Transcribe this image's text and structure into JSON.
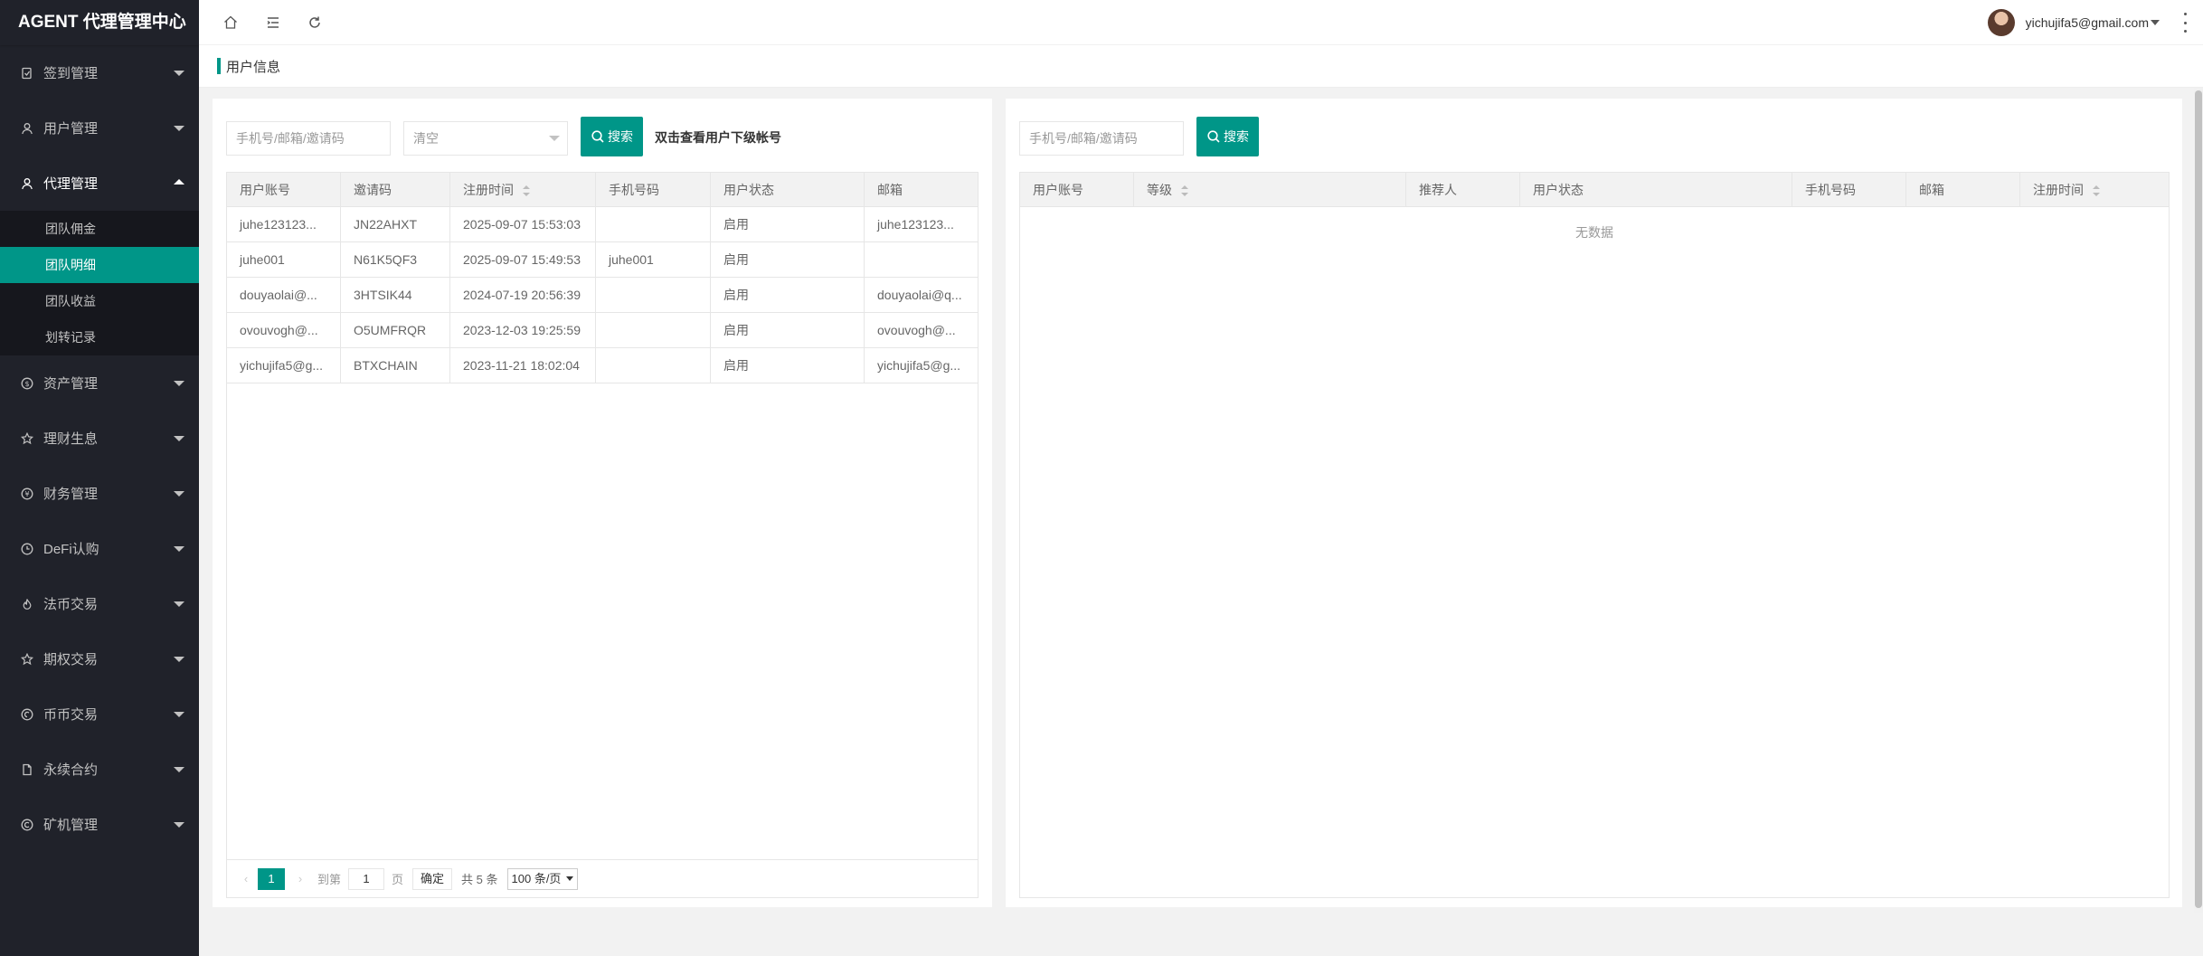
{
  "app": {
    "title": "AGENT 代理管理中心"
  },
  "sidebar": {
    "items": [
      {
        "label": "签到管理",
        "icon": "clipboard-check-icon"
      },
      {
        "label": "用户管理",
        "icon": "user-icon"
      },
      {
        "label": "代理管理",
        "icon": "user-icon",
        "open": true,
        "children": [
          {
            "label": "团队佣金"
          },
          {
            "label": "团队明细",
            "active": true
          },
          {
            "label": "团队收益"
          },
          {
            "label": "划转记录"
          }
        ]
      },
      {
        "label": "资产管理",
        "icon": "dollar-circle-icon"
      },
      {
        "label": "理财生息",
        "icon": "star-icon"
      },
      {
        "label": "财务管理",
        "icon": "yen-circle-icon"
      },
      {
        "label": "DeFi认购",
        "icon": "clock-icon"
      },
      {
        "label": "法币交易",
        "icon": "fire-icon"
      },
      {
        "label": "期权交易",
        "icon": "star-icon"
      },
      {
        "label": "币币交易",
        "icon": "exchange-circle-icon"
      },
      {
        "label": "永续合约",
        "icon": "document-icon"
      },
      {
        "label": "矿机管理",
        "icon": "copyright-icon"
      }
    ]
  },
  "header": {
    "user_email": "yichujifa5@gmail.com"
  },
  "breadcrumb": {
    "title": "用户信息"
  },
  "left_panel": {
    "search_placeholder": "手机号/邮箱/邀请码",
    "select_value": "清空",
    "search_button": "搜索",
    "hint": "双击查看用户下级帐号",
    "columns": [
      "用户账号",
      "邀请码",
      "注册时间",
      "手机号码",
      "用户状态",
      "邮箱"
    ],
    "rows": [
      [
        "juhe123123...",
        "JN22AHXT",
        "2025-09-07 15:53:03",
        "",
        "启用",
        "juhe123123..."
      ],
      [
        "juhe001",
        "N61K5QF3",
        "2025-09-07 15:49:53",
        "juhe001",
        "启用",
        ""
      ],
      [
        "douyaolai@...",
        "3HTSIK44",
        "2024-07-19 20:56:39",
        "",
        "启用",
        "douyaolai@q..."
      ],
      [
        "ovouvogh@...",
        "O5UMFRQR",
        "2023-12-03 19:25:59",
        "",
        "启用",
        "ovouvogh@..."
      ],
      [
        "yichujifa5@g...",
        "BTXCHAIN",
        "2023-11-21 18:02:04",
        "",
        "启用",
        "yichujifa5@g..."
      ]
    ],
    "pager": {
      "current": "1",
      "goto_label": "到第",
      "page_input": "1",
      "page_unit": "页",
      "confirm": "确定",
      "total": "共 5 条",
      "page_size": "100 条/页"
    }
  },
  "right_panel": {
    "search_placeholder": "手机号/邮箱/邀请码",
    "search_button": "搜索",
    "columns": [
      "用户账号",
      "等级",
      "推荐人",
      "用户状态",
      "手机号码",
      "邮箱",
      "注册时间"
    ],
    "empty_text": "无数据"
  },
  "colors": {
    "accent": "#009688",
    "sidebar_bg": "#20222a",
    "submenu_bg": "#16171d"
  }
}
